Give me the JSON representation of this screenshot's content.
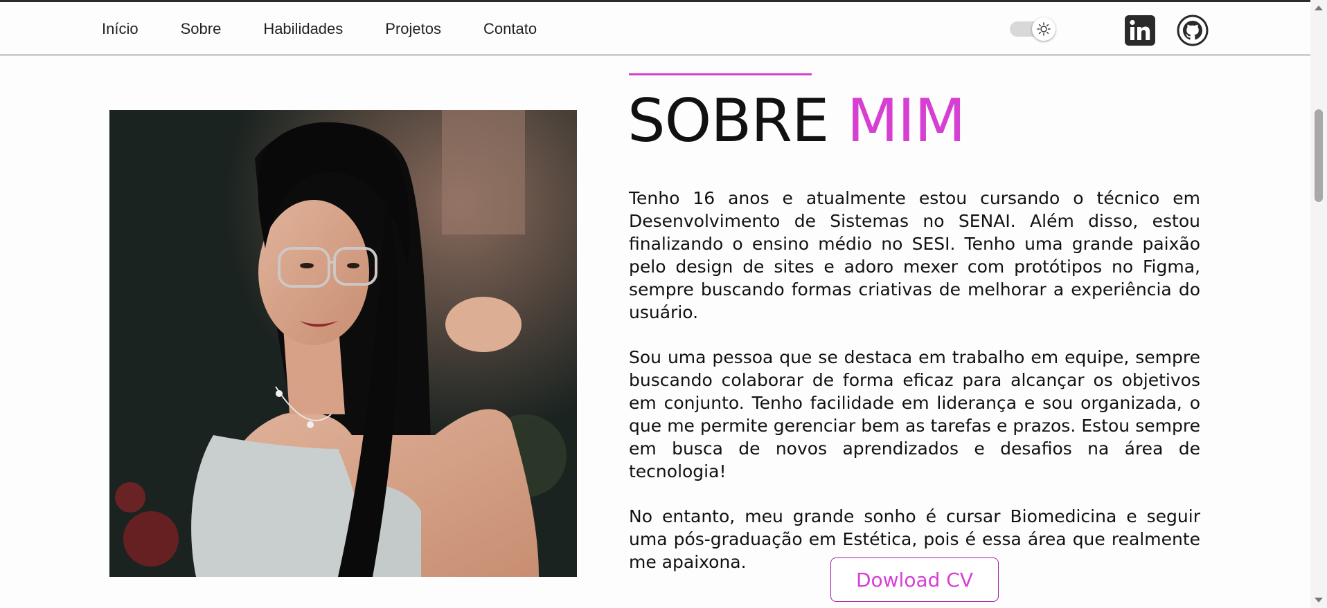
{
  "nav": {
    "links": [
      "Início",
      "Sobre",
      "Habilidades",
      "Projetos",
      "Contato"
    ]
  },
  "theme_toggle": {
    "icon": "sun-icon"
  },
  "social": [
    {
      "icon": "linkedin-icon"
    },
    {
      "icon": "github-icon"
    }
  ],
  "about": {
    "title_main": "SOBRE",
    "title_accent": "MIM",
    "paragraphs": [
      "Tenho 16 anos e atualmente estou cursando o técnico em Desenvolvimento de Sistemas no SENAI. Além disso, estou finalizando o ensino médio no SESI. Tenho uma grande paixão pelo design de sites e adoro mexer com protótipos no Figma, sempre buscando formas criativas de melhorar a experiência do usuário.",
      "Sou uma pessoa que se destaca em trabalho em equipe, sempre buscando colaborar de forma eficaz para alcançar os objetivos em conjunto. Tenho facilidade em liderança e sou organizada, o que me permite gerenciar bem as tarefas e prazos. Estou sempre em busca de novos aprendizados e desafios na área de tecnologia!",
      "No entanto, meu grande sonho é cursar Biomedicina e seguir uma pós-graduação em Estética, pois é essa área que realmente me apaixona."
    ],
    "cv_button": "Dowload CV"
  },
  "colors": {
    "accent": "#d63fd2",
    "text": "#111111",
    "background": "#fdfdfd"
  }
}
